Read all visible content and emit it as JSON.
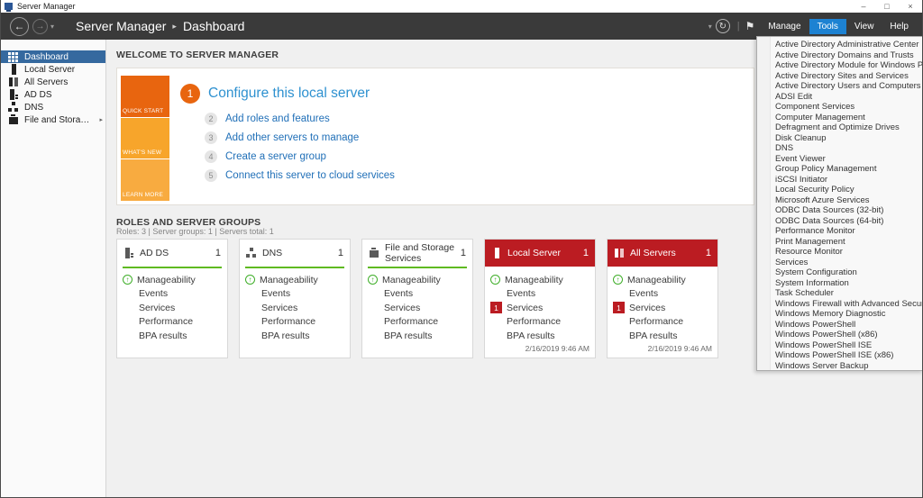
{
  "window": {
    "title": "Server Manager",
    "controls": {
      "minimize": "–",
      "maximize": "□",
      "close": "×"
    }
  },
  "navbar": {
    "back_glyph": "←",
    "forward_glyph": "→",
    "caret_glyph": "▾",
    "refresh_glyph": "↻",
    "separator_glyph": "|",
    "flag_glyph": "⚑",
    "breadcrumb": {
      "root": "Server Manager",
      "separator": "▸",
      "current": "Dashboard"
    },
    "menus": [
      {
        "label": "Manage"
      },
      {
        "label": "Tools",
        "active": true
      },
      {
        "label": "View"
      },
      {
        "label": "Help"
      }
    ]
  },
  "sidebar": {
    "items": [
      {
        "label": "Dashboard",
        "icon": "dashboard-icon",
        "selected": true
      },
      {
        "label": "Local Server",
        "icon": "server-icon"
      },
      {
        "label": "All Servers",
        "icon": "servers-icon"
      },
      {
        "label": "AD DS",
        "icon": "adds-icon"
      },
      {
        "label": "DNS",
        "icon": "dns-icon"
      },
      {
        "label": "File and Storage Services",
        "icon": "storage-icon",
        "expandable": true,
        "expander_glyph": "▸"
      }
    ]
  },
  "welcome": {
    "title": "WELCOME TO SERVER MANAGER",
    "tabs": [
      {
        "label": "QUICK START"
      },
      {
        "label": "WHAT'S NEW"
      },
      {
        "label": "LEARN MORE"
      }
    ],
    "steps": [
      {
        "num": "1",
        "label": "Configure this local server",
        "primary": true
      },
      {
        "num": "2",
        "label": "Add roles and features"
      },
      {
        "num": "3",
        "label": "Add other servers to manage"
      },
      {
        "num": "4",
        "label": "Create a server group"
      },
      {
        "num": "5",
        "label": "Connect this server to cloud services"
      }
    ]
  },
  "roles": {
    "title": "ROLES AND SERVER GROUPS",
    "summary": "Roles: 3   |   Server groups: 1   |   Servers total: 1",
    "cards": [
      {
        "title": "AD DS",
        "count": "1",
        "variant": "normal",
        "icon": "adds-icon",
        "rows": [
          {
            "label": "Manageability",
            "icon": "up-green-icon"
          },
          {
            "label": "Events"
          },
          {
            "label": "Services"
          },
          {
            "label": "Performance"
          },
          {
            "label": "BPA results"
          }
        ]
      },
      {
        "title": "DNS",
        "count": "1",
        "variant": "normal",
        "icon": "dns-icon",
        "rows": [
          {
            "label": "Manageability",
            "icon": "up-green-icon"
          },
          {
            "label": "Events"
          },
          {
            "label": "Services"
          },
          {
            "label": "Performance"
          },
          {
            "label": "BPA results"
          }
        ]
      },
      {
        "title": "File and Storage Services",
        "count": "1",
        "variant": "normal",
        "icon": "storage-icon",
        "rows": [
          {
            "label": "Manageability",
            "icon": "up-green-icon"
          },
          {
            "label": "Events"
          },
          {
            "label": "Services"
          },
          {
            "label": "Performance"
          },
          {
            "label": "BPA results"
          }
        ]
      },
      {
        "title": "Local Server",
        "count": "1",
        "variant": "alert",
        "icon": "server-icon",
        "timestamp": "2/16/2019 9:46 AM",
        "rows": [
          {
            "label": "Manageability",
            "icon": "up-green-icon"
          },
          {
            "label": "Events"
          },
          {
            "label": "Services",
            "badge": "1"
          },
          {
            "label": "Performance"
          },
          {
            "label": "BPA results"
          }
        ]
      },
      {
        "title": "All Servers",
        "count": "1",
        "variant": "alert",
        "icon": "servers-icon",
        "timestamp": "2/16/2019 9:46 AM",
        "rows": [
          {
            "label": "Manageability",
            "icon": "up-green-icon"
          },
          {
            "label": "Events"
          },
          {
            "label": "Services",
            "badge": "1"
          },
          {
            "label": "Performance"
          },
          {
            "label": "BPA results"
          }
        ]
      }
    ]
  },
  "tools_menu": {
    "items": [
      {
        "label": "Active Directory Administrative Center"
      },
      {
        "label": "Active Directory Domains and Trusts"
      },
      {
        "label": "Active Directory Module for Windows PowerShell"
      },
      {
        "label": "Active Directory Sites and Services"
      },
      {
        "label": "Active Directory Users and Computers"
      },
      {
        "label": "ADSI Edit"
      },
      {
        "label": "Component Services"
      },
      {
        "label": "Computer Management"
      },
      {
        "label": "Defragment and Optimize Drives"
      },
      {
        "label": "Disk Cleanup"
      },
      {
        "label": "DNS"
      },
      {
        "label": "Event Viewer"
      },
      {
        "label": "Group Policy Management"
      },
      {
        "label": "iSCSI Initiator"
      },
      {
        "label": "Local Security Policy"
      },
      {
        "label": "Microsoft Azure Services"
      },
      {
        "label": "ODBC Data Sources (32-bit)"
      },
      {
        "label": "ODBC Data Sources (64-bit)"
      },
      {
        "label": "Performance Monitor"
      },
      {
        "label": "Print Management"
      },
      {
        "label": "Resource Monitor"
      },
      {
        "label": "Services"
      },
      {
        "label": "System Configuration"
      },
      {
        "label": "System Information"
      },
      {
        "label": "Task Scheduler"
      },
      {
        "label": "Windows Firewall with Advanced Security"
      },
      {
        "label": "Windows Memory Diagnostic"
      },
      {
        "label": "Windows PowerShell"
      },
      {
        "label": "Windows PowerShell (x86)"
      },
      {
        "label": "Windows PowerShell ISE"
      },
      {
        "label": "Windows PowerShell ISE (x86)"
      },
      {
        "label": "Windows Server Backup"
      }
    ]
  },
  "colors": {
    "navbar_dark": "#3a3a3a",
    "menu_active_blue": "#1d82d2",
    "sidebar_selected_blue": "#35699f",
    "link_blue": "#2170b8",
    "heading_blue": "#2e91d0",
    "quickstart_orange": "#e8650f",
    "whatsnew_orange": "#f7a52b",
    "learnmore_orange": "#f8ab40",
    "ok_green": "#5fba21",
    "alert_red": "#bb1c22"
  }
}
